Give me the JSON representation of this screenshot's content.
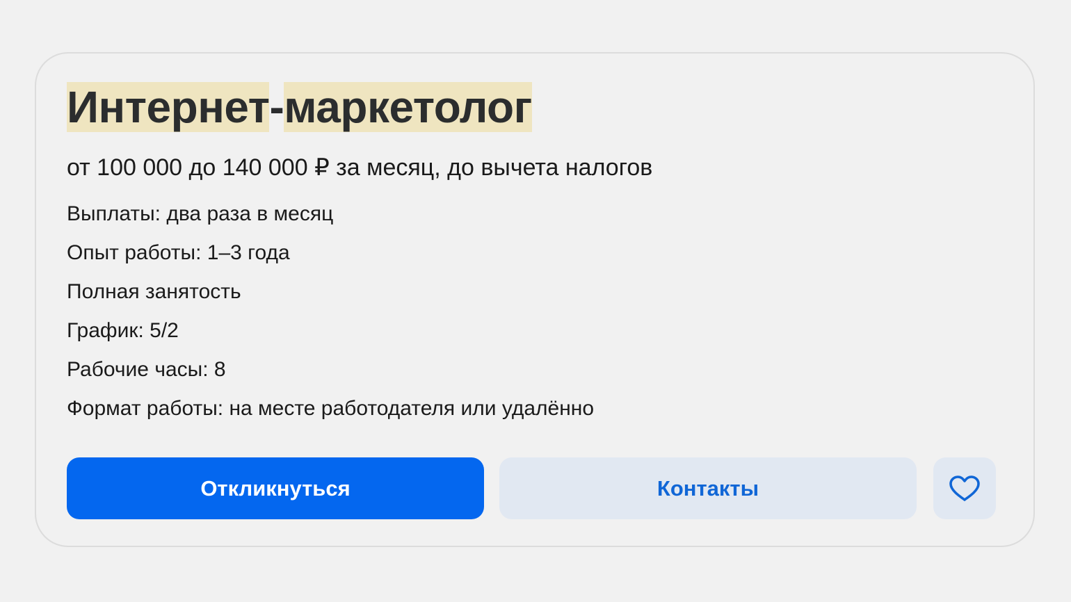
{
  "vacancy": {
    "title_part1": "Интернет",
    "title_hyphen": "-",
    "title_part2": "маркетолог",
    "salary": "от 100 000 до 140 000 ₽ за месяц, до вычета налогов",
    "details": [
      "Выплаты: два раза в месяц",
      "Опыт работы: 1–3 года",
      "Полная занятость",
      "График: 5/2",
      "Рабочие часы: 8",
      "Формат работы: на месте работодателя или удалённо"
    ]
  },
  "actions": {
    "respond_label": "Откликнуться",
    "contacts_label": "Контакты",
    "favorite_icon": "heart-icon"
  },
  "colors": {
    "primary": "#0467ef",
    "secondary_bg": "#e1e8f2",
    "secondary_text": "#1066d6",
    "highlight": "#efe5c0",
    "background": "#f1f1f1"
  }
}
